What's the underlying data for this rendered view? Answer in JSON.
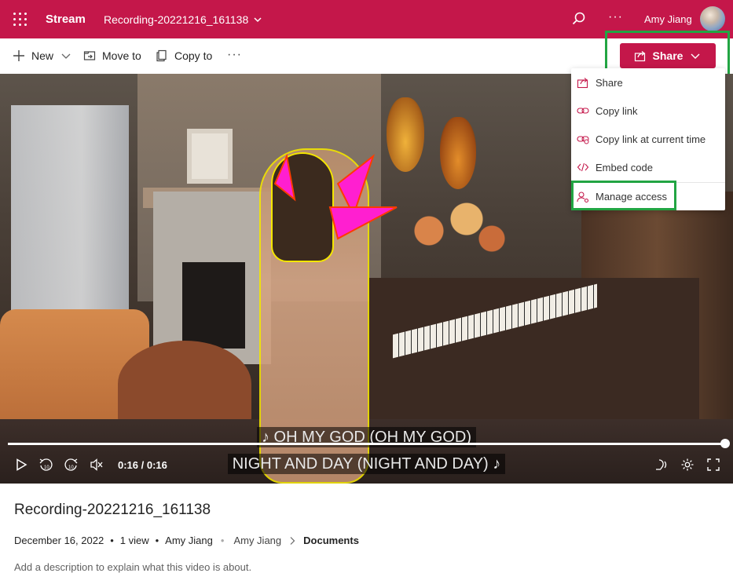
{
  "app": {
    "name": "Stream",
    "document_title": "Recording-20221216_161138",
    "user_name": "Amy Jiang",
    "accent_color": "#c4174a"
  },
  "command_bar": {
    "new_label": "New",
    "move_label": "Move to",
    "copy_label": "Copy to",
    "more_label": "···",
    "share_label": "Share"
  },
  "share_menu": {
    "items": [
      {
        "label": "Share",
        "icon": "share-icon"
      },
      {
        "label": "Copy link",
        "icon": "link-icon"
      },
      {
        "label": "Copy link at current time",
        "icon": "link-time-icon"
      },
      {
        "label": "Embed code",
        "icon": "code-icon"
      },
      {
        "label": "Manage access",
        "icon": "manage-access-icon"
      }
    ],
    "highlight_color": "#22a543"
  },
  "player": {
    "caption_line1": "♪ OH MY GOD (OH MY GOD)",
    "caption_line2": "NIGHT AND DAY (NIGHT AND DAY) ♪",
    "timecode": "0:16 / 0:16",
    "progress": 1.0
  },
  "details": {
    "title": "Recording-20221216_161138",
    "date": "December 16, 2022",
    "views": "1 view",
    "owner": "Amy Jiang",
    "breadcrumb_user": "Amy Jiang",
    "breadcrumb_folder": "Documents",
    "description_placeholder": "Add a description to explain what this video is about."
  }
}
